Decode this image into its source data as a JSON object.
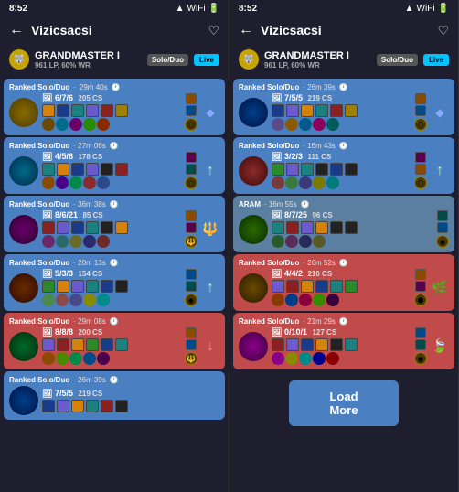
{
  "panels": [
    {
      "id": "left",
      "statusBar": {
        "time": "8:52",
        "signal": "▲▼",
        "wifi": "WiFi",
        "battery": "Battery"
      },
      "header": {
        "title": "Vizicsacsi",
        "backLabel": "←",
        "heartLabel": "♡"
      },
      "playerInfo": {
        "rank": "GRANDMASTER I",
        "lp": "961 LP, 60% WR",
        "queue": "Solo/Duo",
        "isLive": true,
        "liveLabel": "Live"
      },
      "matches": [
        {
          "result": "win",
          "type": "Ranked Solo/Duo",
          "time": "29m 40s",
          "kda": "6/7/6",
          "cs": "205 CS",
          "champColor": "champ-a"
        },
        {
          "result": "win",
          "type": "Ranked Solo/Duo",
          "time": "27m 06s",
          "kda": "4/5/8",
          "cs": "178 CS",
          "champColor": "champ-b"
        },
        {
          "result": "win",
          "type": "Ranked Solo/Duo",
          "time": "36m 38s",
          "kda": "8/6/21",
          "cs": "85 CS",
          "champColor": "champ-c"
        },
        {
          "result": "win",
          "type": "Ranked Solo/Duo",
          "time": "20m 13s",
          "kda": "5/3/3",
          "cs": "154 CS",
          "champColor": "champ-d"
        },
        {
          "result": "loss",
          "type": "Ranked Solo/Duo",
          "time": "29m 08s",
          "kda": "8/8/8",
          "cs": "200 CS",
          "champColor": "champ-e"
        },
        {
          "result": "win",
          "type": "Ranked Solo/Duo",
          "time": "26m 39s",
          "kda": "7/5/5",
          "cs": "219 CS",
          "champColor": "champ-f"
        }
      ]
    },
    {
      "id": "right",
      "statusBar": {
        "time": "8:52",
        "signal": "▲▼",
        "wifi": "WiFi",
        "battery": "Battery"
      },
      "header": {
        "title": "Vizicsacsi",
        "backLabel": "←",
        "heartLabel": "♡"
      },
      "playerInfo": {
        "rank": "GRANDMASTER I",
        "lp": "961 LP, 60% WR",
        "queue": "Solo/Duo",
        "isLive": true,
        "liveLabel": "Live"
      },
      "matches": [
        {
          "result": "win",
          "type": "Ranked Solo/Duo",
          "time": "26m 39s",
          "kda": "7/5/5",
          "cs": "219 CS",
          "champColor": "champ-f"
        },
        {
          "result": "win",
          "type": "Ranked Solo/Duo",
          "time": "16m 43s",
          "kda": "3/2/3",
          "cs": "111 CS",
          "champColor": "champ-g"
        },
        {
          "result": "win",
          "type": "ARAM",
          "time": "16m 55s",
          "kda": "8/7/25",
          "cs": "96 CS",
          "champColor": "champ-h"
        },
        {
          "result": "loss",
          "type": "Ranked Solo/Duo",
          "time": "26m 52s",
          "kda": "4/4/2",
          "cs": "210 CS",
          "champColor": "champ-i"
        },
        {
          "result": "loss",
          "type": "Ranked Solo/Duo",
          "time": "21m 29s",
          "kda": "0/10/1",
          "cs": "127 CS",
          "champColor": "champ-j"
        }
      ],
      "loadMore": {
        "label": "Load More"
      }
    }
  ]
}
